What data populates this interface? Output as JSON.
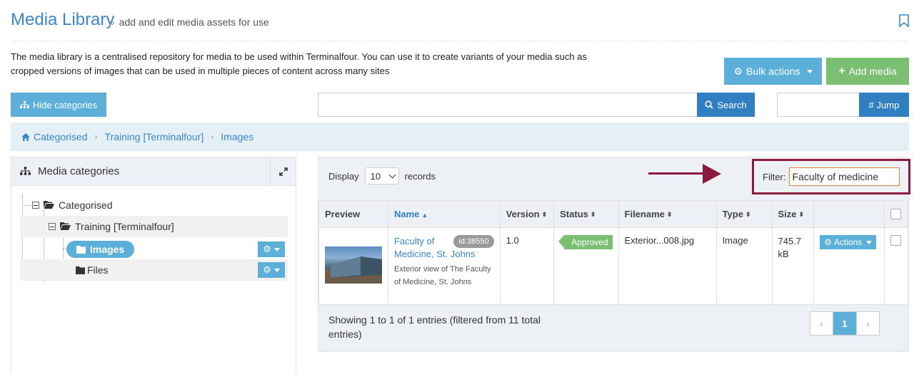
{
  "header": {
    "title": "Media Library",
    "subtitle": "add and edit media assets for use"
  },
  "intro": "The media library is a centralised repository for media to be used within Terminalfour. You can use it to create variants of your media such as cropped versions of images that can be used in multiple pieces of content across many sites",
  "toolbar": {
    "bulk_actions": "Bulk actions",
    "add_media": "Add media",
    "hide_categories": "Hide categories",
    "search_value": "",
    "search_label": "Search",
    "jump_value": "",
    "jump_label": "# Jump"
  },
  "breadcrumb": [
    "Categorised",
    "Training [Terminalfour]",
    "Images"
  ],
  "categories": {
    "title": "Media categories",
    "tree": [
      {
        "label": "Categorised"
      },
      {
        "label": "Training [Terminalfour]"
      },
      {
        "label": "Images",
        "selected": true
      },
      {
        "label": "Files"
      }
    ]
  },
  "listing": {
    "display_label": "Display",
    "records_label": "records",
    "display_value": "10",
    "filter_label": "Filter:",
    "filter_value": "Faculty of medicine",
    "columns": [
      "Preview",
      "Name",
      "Version",
      "Status",
      "Filename",
      "Type",
      "Size"
    ],
    "rows": [
      {
        "name": "Faculty of Medicine, St. Johns",
        "id": "id:38550",
        "description": "Exterior view of The Faculty of Medicine, St. Johns",
        "version": "1.0",
        "status": "Approved",
        "filename": "Exterior...008.jpg",
        "type": "Image",
        "size": "745.7 kB",
        "actions_label": "Actions"
      }
    ],
    "showing": "Showing 1 to 1 of 1 entries (filtered from 11 total entries)",
    "current_page": "1",
    "prev": "‹",
    "next": "›"
  },
  "colors": {
    "brand_blue": "#3a87c9",
    "button_blue": "#5bafd9",
    "button_green": "#7bbf73",
    "annotation": "#8b1a3d"
  }
}
